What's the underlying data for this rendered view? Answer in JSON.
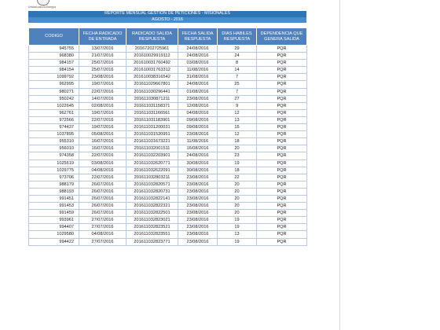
{
  "logo_text": "Unidad para la Energía",
  "report": {
    "title": "REPORTE MENSUAL GESTION DE PETICIONES - MISIONALES",
    "subtitle": "AGOSTO - 2016"
  },
  "table": {
    "columns": [
      "CODIGO",
      "FECHA RADICADO DE ENTRADA",
      "RADICADO SALIDA RESPUESTA",
      "FECHA SALIDA RESPUESTA",
      "DIAS HABILES RESPUESTA",
      "DEPENDENCIA QUE GENERA SALIDA"
    ],
    "rows": [
      [
        "945755",
        "13/07/2016",
        "20167202725961",
        "24/08/2016",
        "29",
        "PQR"
      ],
      [
        "968380",
        "21/07/2016",
        "201610029919112",
        "24/08/2016",
        "24",
        "PQR"
      ],
      [
        "984157",
        "25/07/2016",
        "201610031760492",
        "03/08/2016",
        "8",
        "PQR"
      ],
      [
        "984154",
        "25/07/2016",
        "201610031763312",
        "11/08/2016",
        "14",
        "PQR"
      ],
      [
        "1099792",
        "23/08/2016",
        "201610038316542",
        "31/08/2016",
        "7",
        "PQR"
      ],
      [
        "962995",
        "19/07/2016",
        "201611029667801",
        "24/08/2016",
        "25",
        "PQR"
      ],
      [
        "980271",
        "22/07/2016",
        "201611030296441",
        "01/08/2016",
        "7",
        "PQR"
      ],
      [
        "950242",
        "14/07/2016",
        "201611030871211",
        "23/08/2016",
        "27",
        "PQR"
      ],
      [
        "1022645",
        "02/08/2016",
        "201611031158371",
        "12/08/2016",
        "9",
        "PQR"
      ],
      [
        "962761",
        "19/07/2016",
        "201611031166561",
        "04/08/2016",
        "12",
        "PQR"
      ],
      [
        "972566",
        "22/07/2016",
        "201611031183901",
        "09/08/2016",
        "13",
        "PQR"
      ],
      [
        "974437",
        "19/07/2016",
        "201611031200031",
        "09/08/2016",
        "15",
        "PQR"
      ],
      [
        "1037895",
        "05/08/2016",
        "201611031520951",
        "23/08/2016",
        "12",
        "PQR"
      ],
      [
        "955310",
        "16/07/2016",
        "201611031673221",
        "11/08/2016",
        "18",
        "PQR"
      ],
      [
        "956010",
        "16/07/2016",
        "201611032001511",
        "16/08/2016",
        "20",
        "PQR"
      ],
      [
        "974358",
        "22/07/2016",
        "201611032203901",
        "24/08/2016",
        "23",
        "PQR"
      ],
      [
        "1025619",
        "03/08/2016",
        "201611032620771",
        "30/08/2016",
        "19",
        "PQR"
      ],
      [
        "1029775",
        "04/08/2016",
        "201611032622091",
        "30/08/2016",
        "18",
        "PQR"
      ],
      [
        "973706",
        "22/07/2016",
        "201611032803211",
        "23/08/2016",
        "22",
        "PQR"
      ],
      [
        "988179",
        "26/07/2016",
        "201611032820571",
        "23/08/2016",
        "20",
        "PQR"
      ],
      [
        "988193",
        "26/07/2016",
        "201611032820731",
        "23/08/2016",
        "20",
        "PQR"
      ],
      [
        "991451",
        "26/07/2016",
        "201611032822141",
        "23/08/2016",
        "20",
        "PQR"
      ],
      [
        "991453",
        "26/07/2016",
        "201611032822321",
        "23/08/2016",
        "20",
        "PQR"
      ],
      [
        "991459",
        "26/07/2016",
        "201611032822501",
        "23/08/2016",
        "20",
        "PQR"
      ],
      [
        "993961",
        "27/07/2016",
        "201611032823021",
        "23/08/2016",
        "19",
        "PQR"
      ],
      [
        "994407",
        "27/07/2016",
        "201611032823521",
        "23/08/2016",
        "19",
        "PQR"
      ],
      [
        "1029580",
        "04/08/2016",
        "201611032823551",
        "23/08/2016",
        "13",
        "PQR"
      ],
      [
        "994422",
        "27/07/2016",
        "201611032823771",
        "23/08/2016",
        "19",
        "PQR"
      ]
    ]
  }
}
